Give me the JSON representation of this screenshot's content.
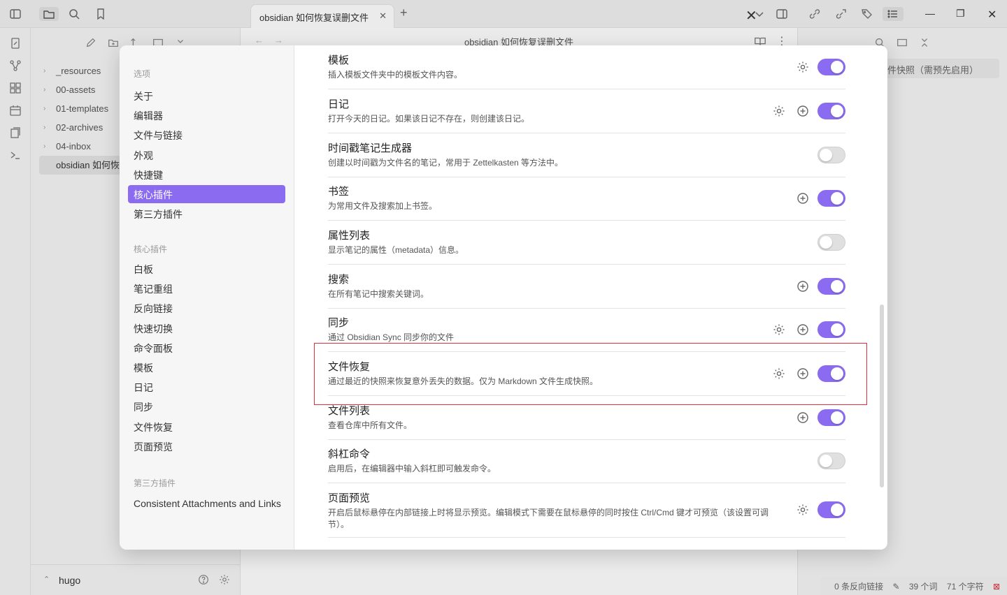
{
  "tab": {
    "title": "obsidian 如何恢复误删文件"
  },
  "editor": {
    "title": "obsidian 如何恢复误删文件"
  },
  "file_tree": {
    "items": [
      {
        "label": "_resources"
      },
      {
        "label": "00-assets"
      },
      {
        "label": "01-templates"
      },
      {
        "label": "02-archives"
      },
      {
        "label": "04-inbox"
      },
      {
        "label": "obsidian 如何恢复误删文件"
      }
    ]
  },
  "vault": {
    "name": "hugo"
  },
  "right_pane": {
    "chip_text": "件快照（需预先启用）"
  },
  "status": {
    "backlinks": "0 条反向链接",
    "words": "39 个词",
    "chars": "71 个字符"
  },
  "settings": {
    "section_options": "选项",
    "options": [
      "关于",
      "编辑器",
      "文件与链接",
      "外观",
      "快捷键",
      "核心插件",
      "第三方插件"
    ],
    "active_option": "核心插件",
    "section_core": "核心插件",
    "core": [
      "白板",
      "笔记重组",
      "反向链接",
      "快速切换",
      "命令面板",
      "模板",
      "日记",
      "同步",
      "文件恢复",
      "页面预览"
    ],
    "section_third": "第三方插件",
    "third": [
      "Consistent Attachments and Links"
    ]
  },
  "plugins": [
    {
      "name": "模板",
      "desc": "插入模板文件夹中的模板文件内容。",
      "gear": true,
      "plus": false,
      "enabled": true
    },
    {
      "name": "日记",
      "desc": "打开今天的日记。如果该日记不存在，则创建该日记。",
      "gear": true,
      "plus": true,
      "enabled": true
    },
    {
      "name": "时间戳笔记生成器",
      "desc": "创建以时间戳为文件名的笔记，常用于 Zettelkasten 等方法中。",
      "gear": false,
      "plus": false,
      "enabled": false
    },
    {
      "name": "书签",
      "desc": "为常用文件及搜索加上书签。",
      "gear": false,
      "plus": true,
      "enabled": true
    },
    {
      "name": "属性列表",
      "desc": "显示笔记的属性（metadata）信息。",
      "gear": false,
      "plus": false,
      "enabled": false
    },
    {
      "name": "搜索",
      "desc": "在所有笔记中搜索关键词。",
      "gear": false,
      "plus": true,
      "enabled": true
    },
    {
      "name": "同步",
      "desc": "通过 Obsidian Sync 同步你的文件",
      "gear": true,
      "plus": true,
      "enabled": true
    },
    {
      "name": "文件恢复",
      "desc": "通过最近的快照来恢复意外丢失的数据。仅为 Markdown 文件生成快照。",
      "gear": true,
      "plus": true,
      "enabled": true
    },
    {
      "name": "文件列表",
      "desc": "查看仓库中所有文件。",
      "gear": false,
      "plus": true,
      "enabled": true
    },
    {
      "name": "斜杠命令",
      "desc": "启用后，在编辑器中输入斜杠即可触发命令。",
      "gear": false,
      "plus": false,
      "enabled": false
    },
    {
      "name": "页面预览",
      "desc": "开启后鼠标悬停在内部链接上时将显示预览。编辑模式下需要在鼠标悬停的同时按住 Ctrl/Cmd 键才可预览（该设置可调节）。",
      "gear": true,
      "plus": false,
      "enabled": true
    }
  ],
  "icons": {
    "sidebar_toggle": "sidebar-toggle-icon",
    "folder": "folder-icon",
    "search": "search-icon",
    "bookmark": "bookmark-icon",
    "gear": "gear-icon",
    "plus": "plus-circle-icon",
    "close": "close-icon"
  },
  "colors": {
    "accent": "#8b6cf0",
    "highlight": "#e0303a"
  }
}
